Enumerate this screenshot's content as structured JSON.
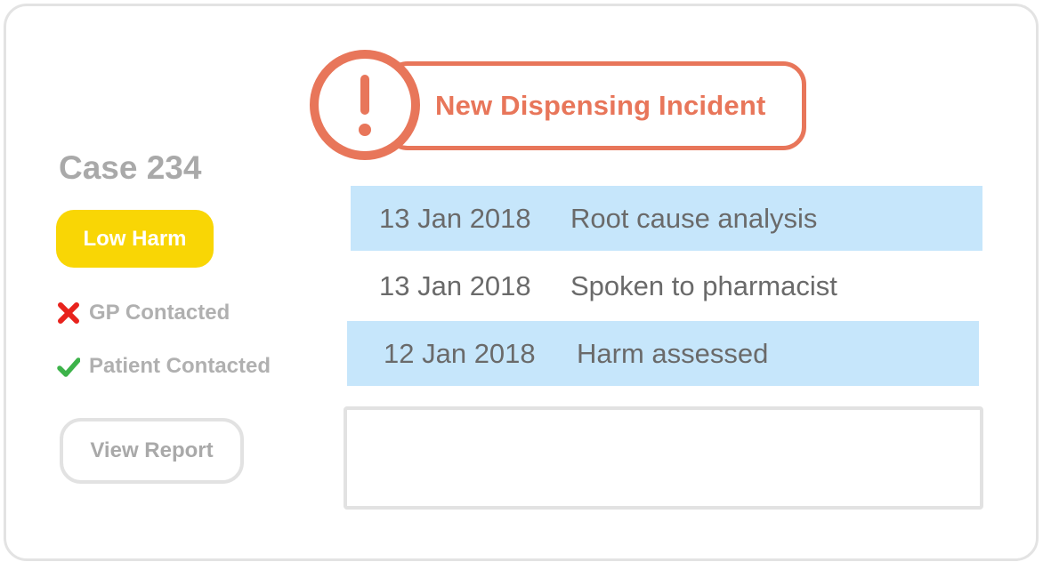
{
  "alert": {
    "title": "New Dispensing Incident",
    "icon": "exclamation-icon",
    "color": "#e8765a"
  },
  "case": {
    "title": "Case 234",
    "harm_level": "Low Harm",
    "harm_color": "#f9d605",
    "statuses": [
      {
        "label": "GP Contacted",
        "done": false,
        "icon": "cross-icon",
        "icon_color": "#e8231d"
      },
      {
        "label": "Patient Contacted",
        "done": true,
        "icon": "check-icon",
        "icon_color": "#3db34a"
      }
    ],
    "report_button": "View Report"
  },
  "timeline": [
    {
      "date": "13 Jan 2018",
      "event": "Root cause analysis",
      "highlighted": true
    },
    {
      "date": "13 Jan 2018",
      "event": "Spoken to pharmacist",
      "highlighted": false
    },
    {
      "date": "12 Jan 2018",
      "event": "Harm assessed",
      "highlighted": true
    }
  ],
  "notes": {
    "value": ""
  }
}
